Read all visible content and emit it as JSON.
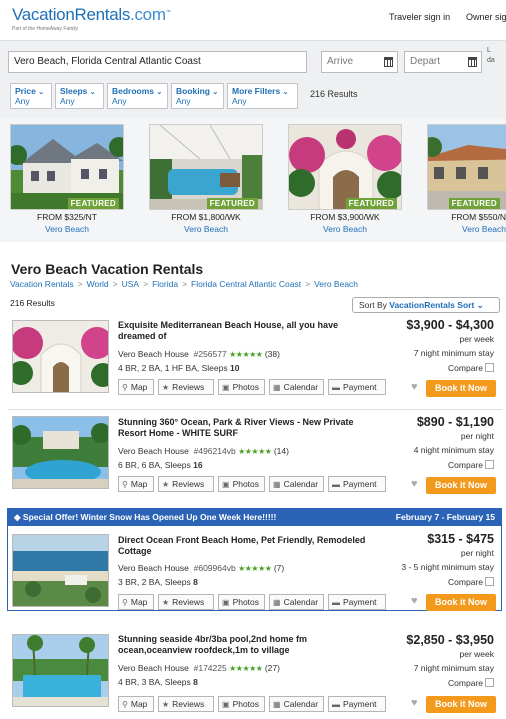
{
  "header": {
    "logo": "VacationRentals",
    "logo_suffix": ".com",
    "logo_tm": "™",
    "logo_sub": "Part of the HomeAway Family",
    "traveler_signin": "Traveler sign in",
    "owner_signin": "Owner sig"
  },
  "search": {
    "location": "Vero Beach, Florida Central Atlantic Coast",
    "arrive_placeholder": "Arrive",
    "depart_placeholder": "Depart",
    "lastmin_line1": "L",
    "lastmin_line2": "da"
  },
  "filters": [
    {
      "label": "Price",
      "value": "Any"
    },
    {
      "label": "Sleeps",
      "value": "Any"
    },
    {
      "label": "Bedrooms",
      "value": "Any"
    },
    {
      "label": "Booking",
      "value": "Any"
    },
    {
      "label": "More Filters",
      "value": "Any"
    }
  ],
  "results_top": "216 Results",
  "featured": [
    {
      "badge": "FEATURED",
      "price": "FROM $325/NT",
      "location": "Vero Beach"
    },
    {
      "badge": "FEATURED",
      "price": "FROM $1,800/WK",
      "location": "Vero Beach"
    },
    {
      "badge": "FEATURED",
      "price": "FROM $3,900/WK",
      "location": "Vero Beach"
    },
    {
      "badge": "FEATURED",
      "price": "FROM $550/N",
      "location": "Vero Beach"
    }
  ],
  "page_title": "Vero Beach Vacation Rentals",
  "breadcrumb": [
    "Vacation Rentals",
    "World",
    "USA",
    "Florida",
    "Florida Central Atlantic Coast",
    "Vero Beach"
  ],
  "breadcrumb_sep": ">",
  "results_count": "216 Results",
  "sort": {
    "label": "Sort By",
    "value": "VacationRentals Sort",
    "chevron": "⌄"
  },
  "toolbar": {
    "map": "Map",
    "reviews": "Reviews",
    "photos": "Photos",
    "calendar": "Calendar",
    "payment": "Payment",
    "book": "Book it Now",
    "compare": "Compare"
  },
  "special": {
    "text": "Special Offer!  Winter Snow Has Opened Up One Week Here!!!!!",
    "dates": "February 7 - February 15",
    "tag_icon": "tag-icon"
  },
  "listings": [
    {
      "title": "Exquisite Mediterranean Beach House, all you have dreamed of",
      "type": "Vero Beach House",
      "id": "#256577",
      "stars": "★★★★★",
      "reviews": "(38)",
      "beds_a": "4 BR, 2 BA, 1 HF BA, Sleeps ",
      "beds_b": "10",
      "price": "$3,900 - $4,300",
      "per": "per week",
      "minstay": "7 night minimum stay"
    },
    {
      "title": "Stunning 360° Ocean, Park & River Views - New Private Resort Home - WHITE SURF",
      "type": "Vero Beach House",
      "id": "#496214vb",
      "stars": "★★★★★",
      "reviews": "(14)",
      "beds_a": "6 BR, 6 BA, Sleeps ",
      "beds_b": "16",
      "price": "$890 - $1,190",
      "per": "per night",
      "minstay": "4 night minimum stay"
    },
    {
      "title": "Direct Ocean Front Beach Home, Pet Friendly, Remodeled Cottage",
      "type": "Vero Beach House",
      "id": "#609964vb",
      "stars": "★★★★★",
      "reviews": "(7)",
      "beds_a": "3 BR, 2 BA, Sleeps ",
      "beds_b": "8",
      "price": "$315 - $475",
      "per": "per night",
      "minstay": "3 - 5 night minimum stay"
    },
    {
      "title": "Stunning seaside 4br/3ba pool,2nd home fm ocean,oceanview roofdeck,1m to village",
      "type": "Vero Beach House",
      "id": "#174225",
      "stars": "★★★★★",
      "reviews": "(27)",
      "beds_a": "4 BR, 3 BA, Sleeps ",
      "beds_b": "8",
      "price": "$2,850 - $3,950",
      "per": "per week",
      "minstay": "7 night minimum stay"
    }
  ],
  "colors": {
    "brand_blue": "#1f6fb8",
    "book_orange": "#f39a1c",
    "featured_green": "#6fa33a",
    "special_blue": "#2b63b6",
    "star_green": "#4a9e24"
  },
  "icons": [
    "map-pin-icon",
    "star-icon",
    "camera-icon",
    "calendar-icon",
    "payment-icon",
    "heart-icon",
    "calendar-icon",
    "chevron-down-icon"
  ]
}
